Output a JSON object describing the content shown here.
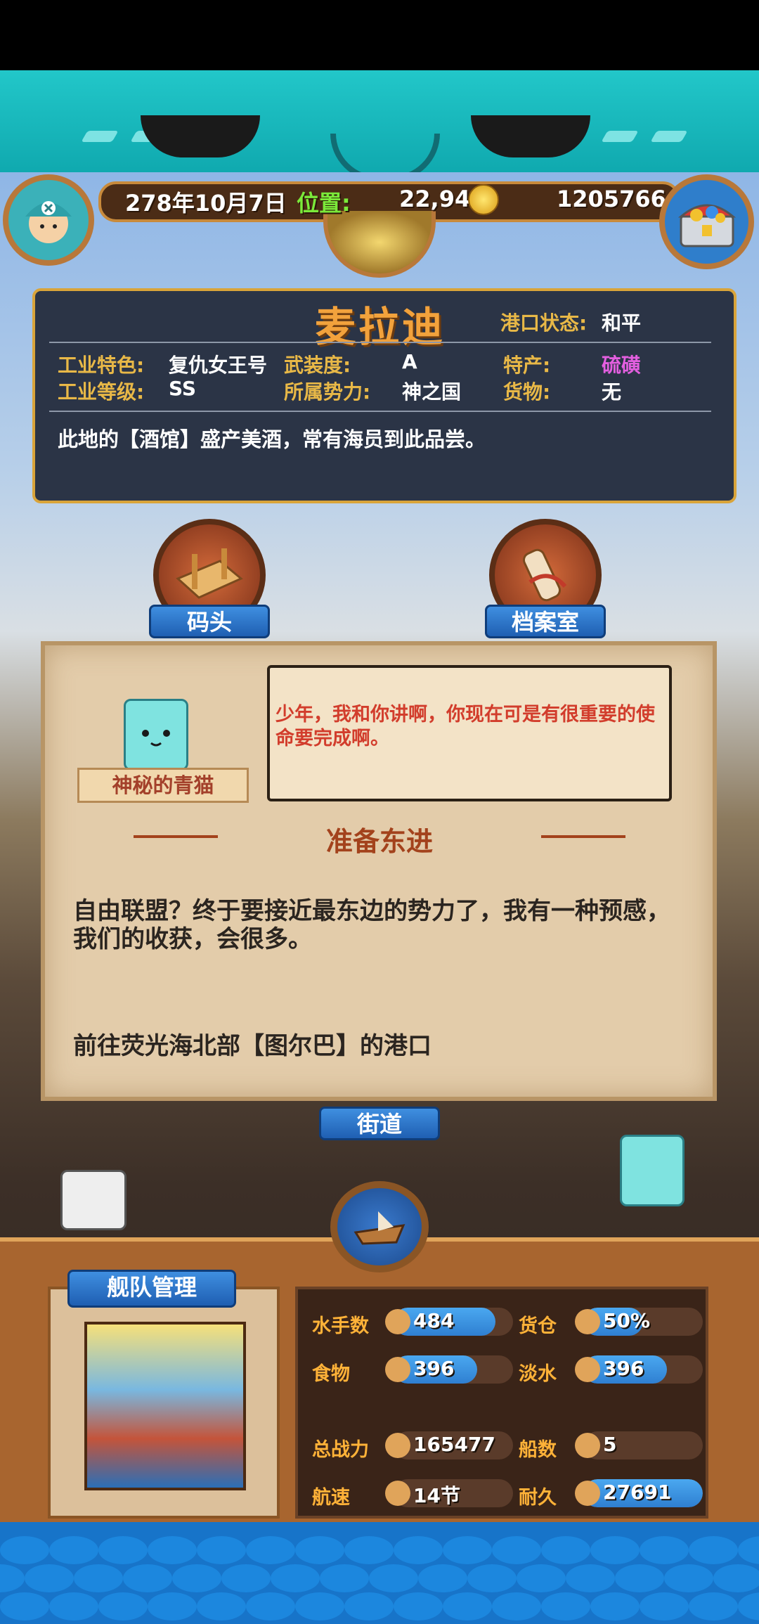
{
  "top": {
    "date": "278年10月7日",
    "position_label": "位置:",
    "position_value": "22,94",
    "gold": "1205766"
  },
  "port": {
    "name": "麦拉迪",
    "status_label": "港口状态:",
    "status_value": "和平",
    "fields": [
      {
        "label": "工业特色:",
        "value": "复仇女王号"
      },
      {
        "label": "武装度:",
        "value": "A"
      },
      {
        "label": "特产:",
        "value": "硫磺",
        "color": "#e45fe0"
      },
      {
        "label": "工业等级:",
        "value": "SS"
      },
      {
        "label": "所属势力:",
        "value": "神之国"
      },
      {
        "label": "货物:",
        "value": "无"
      }
    ],
    "description": "此地的【酒馆】盛产美酒，常有海员到此品尝。"
  },
  "buildings": {
    "dock": "码头",
    "archive": "档案室",
    "street": "街道"
  },
  "dialog": {
    "speaker": "神秘的青猫",
    "bubble": "少年，我和你讲啊，你现在可是有很重要的使命要完成啊。",
    "quest_title": "准备东进",
    "quest_body": "自由联盟？终于要接近最东边的势力了，我有一种预感，我们的收获，会很多。",
    "quest_goal": "前往荧光海北部【图尔巴】的港口"
  },
  "fleet": {
    "title": "舰队管理",
    "stats": [
      {
        "label": "水手数",
        "value": "484",
        "fill": 0.85,
        "icon": "sailor-icon"
      },
      {
        "label": "货仓",
        "value": "50%",
        "fill": 0.5,
        "icon": "cargo-icon"
      },
      {
        "label": "食物",
        "value": "396",
        "fill": 0.7,
        "icon": "food-icon"
      },
      {
        "label": "淡水",
        "value": "396",
        "fill": 0.7,
        "icon": "water-icon"
      },
      {
        "label": "总战力",
        "value": "165477",
        "fill": 0,
        "icon": "power-icon"
      },
      {
        "label": "船数",
        "value": "5",
        "fill": 0,
        "icon": "ship-count-icon"
      },
      {
        "label": "航速",
        "value": "14节",
        "fill": 0,
        "icon": "speed-icon"
      },
      {
        "label": "耐久",
        "value": "27691",
        "fill": 1.0,
        "icon": "durability-icon"
      }
    ]
  },
  "colors": {
    "accent": "#e8b847",
    "panel": "#2b3446",
    "quest_title": "#a3421c"
  }
}
